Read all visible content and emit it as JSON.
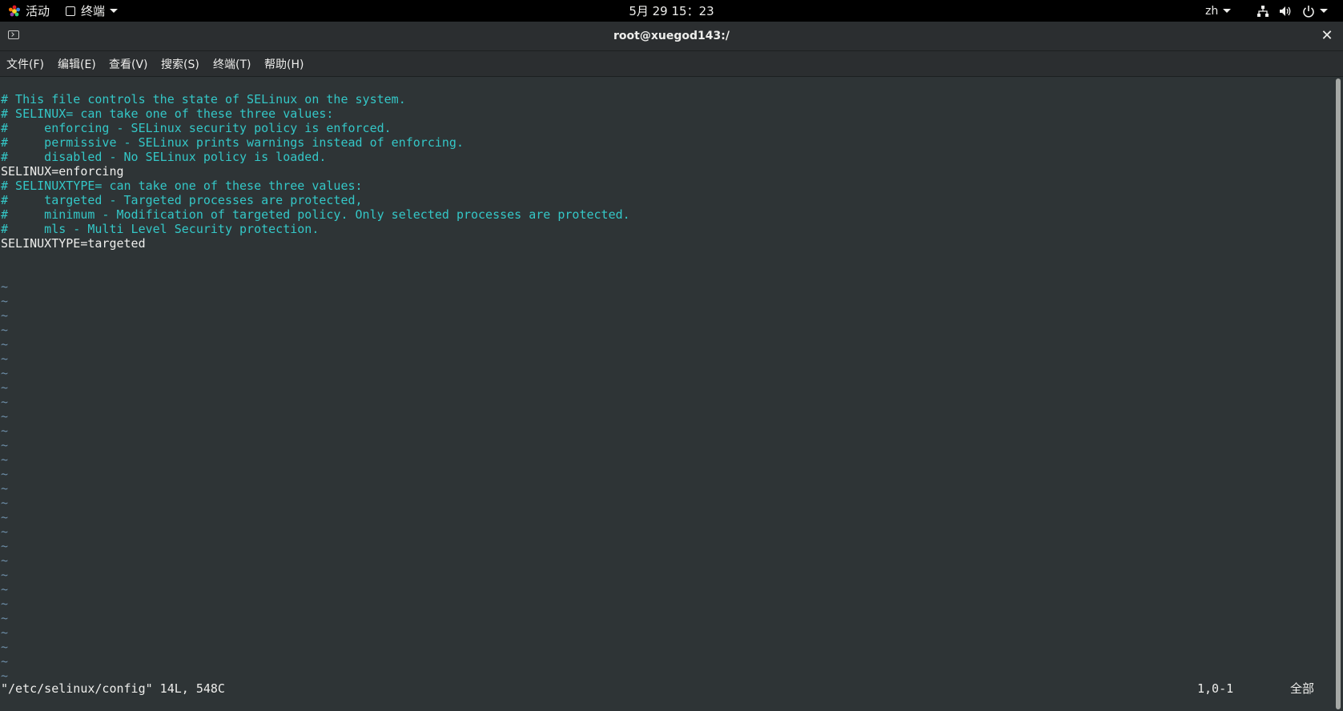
{
  "topbar": {
    "activities": "活动",
    "app_menu": "终端",
    "clock": "5月 29  15：23",
    "language": "zh",
    "icons": [
      "network-icon",
      "volume-icon",
      "power-icon"
    ]
  },
  "window": {
    "title": "root@xuegod143:/",
    "close_glyph": "✕"
  },
  "menubar": {
    "items": [
      "文件(F)",
      "编辑(E)",
      "查看(V)",
      "搜索(S)",
      "终端(T)",
      "帮助(H)"
    ]
  },
  "editor": {
    "lines": [
      "",
      "# This file controls the state of SELinux on the system.",
      "# SELINUX= can take one of these three values:",
      "#     enforcing - SELinux security policy is enforced.",
      "#     permissive - SELinux prints warnings instead of enforcing.",
      "#     disabled - No SELinux policy is loaded.",
      "SELINUX=enforcing",
      "# SELINUXTYPE= can take one of these three values:",
      "#     targeted - Targeted processes are protected,",
      "#     minimum - Modification of targeted policy. Only selected processes are protected.",
      "#     mls - Multi Level Security protection.",
      "SELINUXTYPE=targeted",
      "",
      ""
    ],
    "empty_line_marker": "~",
    "empty_line_count": 28,
    "status": {
      "file_info": "\"/etc/selinux/config\" 14L, 548C",
      "position": "1,0-1",
      "scroll": "全部"
    }
  },
  "colors": {
    "background": "#2e3436",
    "comment": "#34c7c7",
    "text": "#eeeeec",
    "tilde": "#6d8ea8"
  }
}
